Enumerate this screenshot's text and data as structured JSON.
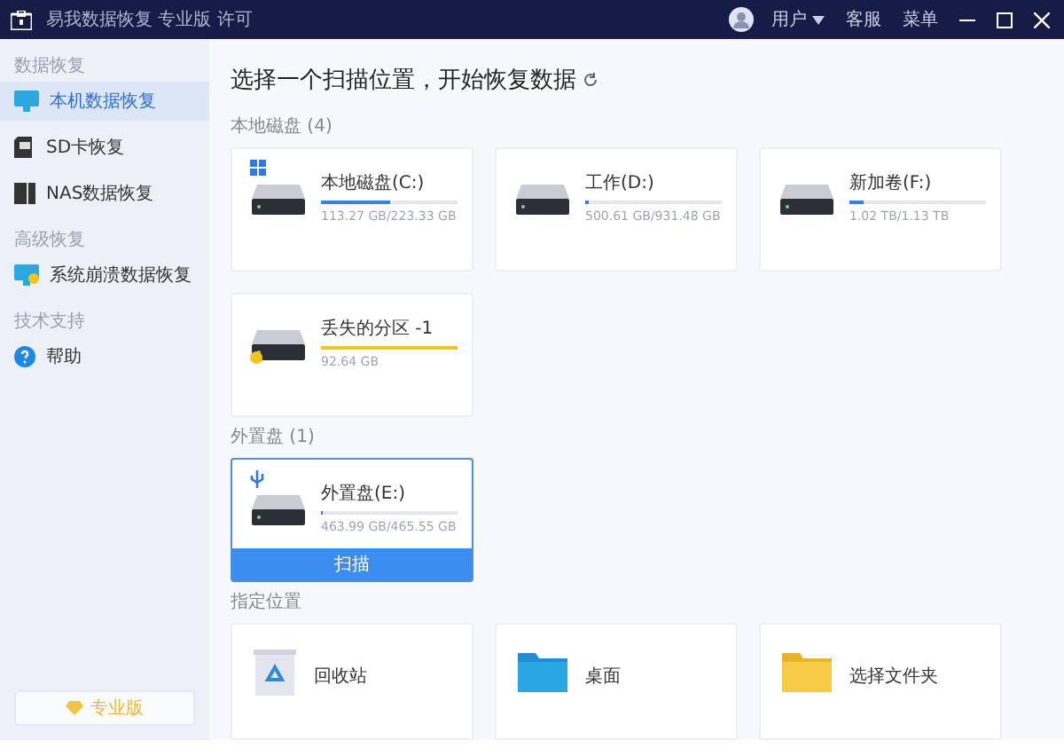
{
  "window": {
    "title": "易我数据恢复 专业版 许可"
  },
  "titlebar": {
    "user": "用户",
    "links": [
      "客服",
      "菜单"
    ]
  },
  "sidebar": {
    "sections": [
      {
        "label": "数据恢复",
        "items": [
          {
            "label": "本机数据恢复",
            "kind": "monitor",
            "selected": true
          },
          {
            "label": "SD卡恢复",
            "kind": "sd",
            "selected": false
          },
          {
            "label": "NAS数据恢复",
            "kind": "nas",
            "selected": false
          }
        ]
      },
      {
        "label": "高级恢复",
        "items": [
          {
            "label": "系统崩溃数据恢复",
            "kind": "crash",
            "selected": false
          }
        ]
      },
      {
        "label": "技术支持",
        "items": [
          {
            "label": "帮助",
            "kind": "help",
            "selected": false
          }
        ]
      }
    ],
    "upgrade": "专业版"
  },
  "main": {
    "heading": "选择一个扫描位置，开始恢复数据",
    "scan_button": "扫描",
    "groups": [
      {
        "label": "本地磁盘 (4)",
        "drives": [
          {
            "name": "本地磁盘(C:)",
            "kind": "system",
            "level": 0.5,
            "capacity": "113.27 GB/223.33 GB",
            "selected": false
          },
          {
            "name": "工作(D:)",
            "kind": "plain",
            "level": 0.03,
            "capacity": "500.61 GB/931.48 GB",
            "selected": false
          },
          {
            "name": "新加卷(F:)",
            "kind": "plain",
            "level": 0.1,
            "capacity": "1.02 TB/1.13 TB",
            "selected": false
          },
          {
            "name": "丢失的分区 -1",
            "kind": "lost",
            "level": 1,
            "capacity": "92.64 GB",
            "selected": false
          }
        ]
      },
      {
        "label": "外置盘 (1)",
        "drives": [
          {
            "name": "外置盘(E:)",
            "kind": "usb",
            "level": 0.01,
            "capacity": "463.99 GB/465.55 GB",
            "selected": true
          }
        ]
      }
    ],
    "locations": {
      "label": "指定位置",
      "items": [
        {
          "label": "回收站",
          "kind": "recycle"
        },
        {
          "label": "桌面",
          "kind": "desktop"
        },
        {
          "label": "选择文件夹",
          "kind": "folder"
        }
      ]
    }
  }
}
